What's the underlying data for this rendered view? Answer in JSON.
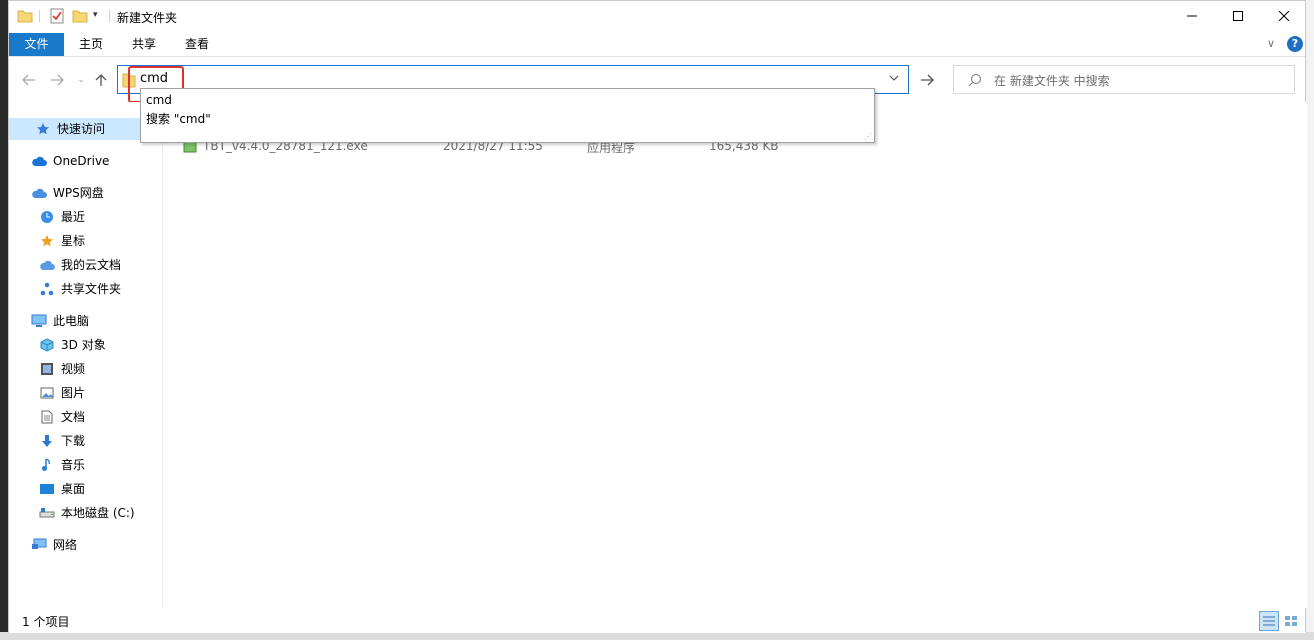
{
  "window": {
    "title": "新建文件夹"
  },
  "ribbon": {
    "tabs": [
      "文件",
      "主页",
      "共享",
      "查看"
    ]
  },
  "address": {
    "value": "cmd"
  },
  "autocomplete": {
    "items": [
      "cmd",
      "搜索 \"cmd\""
    ]
  },
  "search": {
    "placeholder": "在 新建文件夹 中搜索"
  },
  "nav": {
    "items": [
      {
        "label": "快速访问",
        "icon": "star-icon"
      },
      {
        "label": "OneDrive",
        "icon": "cloud-icon"
      },
      {
        "label": "WPS网盘",
        "icon": "cloud-icon"
      },
      {
        "label": "最近",
        "icon": "clock-icon"
      },
      {
        "label": "星标",
        "icon": "star-icon"
      },
      {
        "label": "我的云文档",
        "icon": "cloud-icon"
      },
      {
        "label": "共享文件夹",
        "icon": "share-icon"
      },
      {
        "label": "此电脑",
        "icon": "monitor-icon"
      },
      {
        "label": "3D 对象",
        "icon": "cube-icon"
      },
      {
        "label": "视频",
        "icon": "film-icon"
      },
      {
        "label": "图片",
        "icon": "picture-icon"
      },
      {
        "label": "文档",
        "icon": "document-icon"
      },
      {
        "label": "下载",
        "icon": "download-icon"
      },
      {
        "label": "音乐",
        "icon": "music-icon"
      },
      {
        "label": "桌面",
        "icon": "desktop-icon"
      },
      {
        "label": "本地磁盘 (C:)",
        "icon": "drive-icon"
      },
      {
        "label": "网络",
        "icon": "network-icon"
      }
    ]
  },
  "files": [
    {
      "name": "TBT_v4.4.0_28781_121.exe",
      "date": "2021/8/27 11:55",
      "type": "应用程序",
      "size": "165,438 KB"
    }
  ],
  "status": {
    "text": "1 个项目"
  },
  "colors": {
    "accent": "#1979ca",
    "selection": "#cce8ff",
    "highlight_box": "#e0302a"
  }
}
